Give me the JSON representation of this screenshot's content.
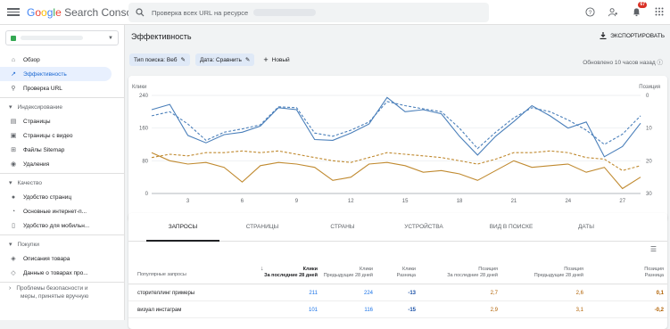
{
  "app": {
    "title_letters": [
      "G",
      "o",
      "o",
      "g",
      "l",
      "e"
    ],
    "product": "Search Console",
    "search_placeholder": "Проверка всех URL на ресурсе",
    "notif_count": "67"
  },
  "sidebar": {
    "items": [
      {
        "label": "Обзор",
        "icon": "home-icon"
      },
      {
        "label": "Эффективность",
        "icon": "trending-up-icon",
        "active": true
      },
      {
        "label": "Проверка URL",
        "icon": "search-icon"
      }
    ],
    "section_index": "Индексирование",
    "index_items": [
      {
        "label": "Страницы",
        "icon": "pages-icon"
      },
      {
        "label": "Страницы с видео",
        "icon": "video-icon"
      },
      {
        "label": "Файлы Sitemap",
        "icon": "sitemap-icon"
      },
      {
        "label": "Удаления",
        "icon": "eye-off-icon"
      }
    ],
    "section_quality": "Качество",
    "quality_items": [
      {
        "label": "Удобство страниц",
        "icon": "gauge-icon"
      },
      {
        "label": "Основные интернет-п...",
        "icon": "speed-icon"
      },
      {
        "label": "Удобство для мобильн...",
        "icon": "mobile-icon"
      }
    ],
    "section_shop": "Покупки",
    "shop_items": [
      {
        "label": "Описания товара",
        "icon": "tag-icon"
      },
      {
        "label": "Данные о товарах про...",
        "icon": "product-icon"
      }
    ],
    "section_security": "Проблемы безопасности и",
    "section_security_2": "меры, принятые вручную"
  },
  "main": {
    "title": "Эффективность",
    "export_label": "ЭКСПОРТИРОВАТЬ",
    "filter_search_type": "Тип поиска: Веб",
    "filter_date": "Дата: Сравнить",
    "new_label": "Новый",
    "updated": "Обновлено 10 часов назад"
  },
  "chart_data": {
    "type": "line",
    "left_axis_label": "Клики",
    "right_axis_label": "Позиция",
    "left_ticks": [
      "240",
      "160",
      "80",
      "0"
    ],
    "right_ticks": [
      "0",
      "10",
      "20",
      "30"
    ],
    "x_ticks": [
      "3",
      "6",
      "9",
      "12",
      "15",
      "18",
      "21",
      "24",
      "27"
    ],
    "ylim_left": [
      0,
      240
    ],
    "ylim_right": [
      0,
      30
    ],
    "x_count": 28,
    "series": [
      {
        "metric": "clicks",
        "period": "last",
        "color": "#4a7fba",
        "dashed": false,
        "values": [
          205,
          218,
          142,
          124,
          144,
          150,
          165,
          210,
          205,
          132,
          130,
          148,
          170,
          235,
          200,
          205,
          195,
          140,
          94,
          140,
          176,
          215,
          190,
          160,
          175,
          90,
          115,
          172
        ]
      },
      {
        "metric": "clicks",
        "period": "previous",
        "color": "#4a7fba",
        "dashed": true,
        "values": [
          190,
          200,
          170,
          130,
          150,
          158,
          168,
          212,
          210,
          148,
          140,
          155,
          175,
          225,
          215,
          207,
          200,
          160,
          110,
          150,
          185,
          210,
          200,
          180,
          155,
          120,
          145,
          190
        ]
      },
      {
        "metric": "position",
        "period": "last",
        "color": "#c08a30",
        "dashed": false,
        "values": [
          17.5,
          20,
          21,
          20.5,
          22,
          26.5,
          21.5,
          20.5,
          21,
          22,
          26,
          25,
          21,
          20.5,
          21.5,
          23.5,
          23,
          24,
          26,
          23,
          20,
          22,
          21.5,
          21,
          23.5,
          22,
          28.5,
          25
        ]
      },
      {
        "metric": "position",
        "period": "previous",
        "color": "#c08a30",
        "dashed": true,
        "values": [
          19,
          18,
          18.5,
          17.5,
          17.5,
          17,
          17.5,
          17,
          18,
          19,
          20,
          20.5,
          19,
          17.5,
          18,
          18.5,
          19,
          20,
          21,
          19.5,
          17.5,
          17.5,
          17,
          17.5,
          19,
          19.5,
          23,
          21.5
        ]
      }
    ]
  },
  "tabs": [
    "ЗАПРОСЫ",
    "СТРАНИЦЫ",
    "СТРАНЫ",
    "УСТРОЙСТВА",
    "ВИД В ПОИСКЕ",
    "ДАТЫ"
  ],
  "table": {
    "col_query": "Популярные запросы",
    "col_sort": "↓",
    "col_clicks_1": "Клики",
    "col_clicks_1_sub": "За последние 28 дней",
    "col_clicks_2": "Клики",
    "col_clicks_2_sub": "Предыдущие 28 дней",
    "col_clicks_3": "Клики",
    "col_clicks_3_sub": "Разница",
    "col_pos_1": "Позиция",
    "col_pos_1_sub": "За последние 28 дней",
    "col_pos_2": "Позиция",
    "col_pos_2_sub": "Предыдущие 28 дней",
    "col_pos_3": "Позиция",
    "col_pos_3_sub": "Разница",
    "rows": [
      {
        "query": "сторителлинг примеры",
        "c1": "211",
        "c2": "224",
        "c3": "-13",
        "p1": "2,7",
        "p2": "2,6",
        "p3": "0,1"
      },
      {
        "query": "визуал инстаграм",
        "c1": "101",
        "c2": "116",
        "c3": "-15",
        "p1": "2,9",
        "p2": "3,1",
        "p3": "-0,2"
      }
    ]
  }
}
